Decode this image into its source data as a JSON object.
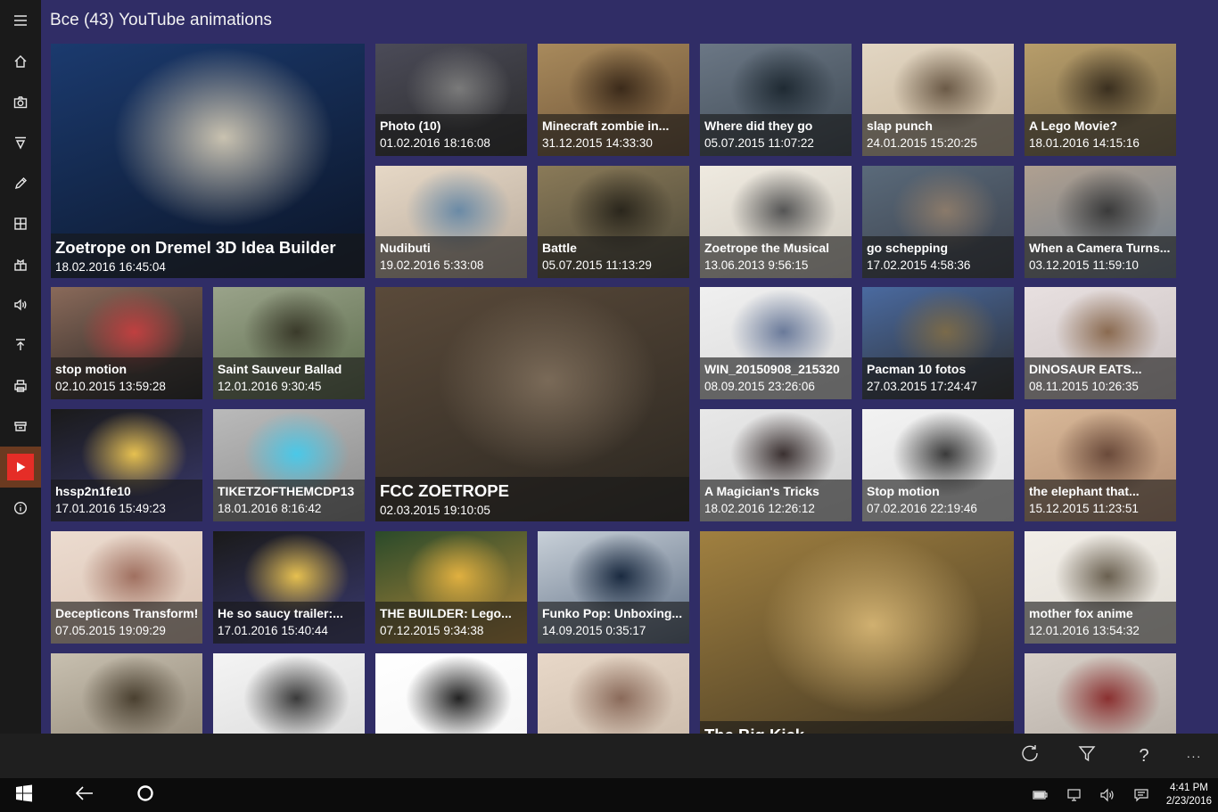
{
  "header": {
    "title": "Все (43) YouTube animations"
  },
  "sidebar": {
    "items": [
      {
        "icon": "menu-icon"
      },
      {
        "icon": "home-icon"
      },
      {
        "icon": "camera-icon"
      },
      {
        "icon": "filter-icon"
      },
      {
        "icon": "pencil-icon"
      },
      {
        "icon": "grid-icon"
      },
      {
        "icon": "tiles-icon"
      },
      {
        "icon": "speaker-icon"
      },
      {
        "icon": "upload-icon"
      },
      {
        "icon": "printer-icon"
      },
      {
        "icon": "store-icon"
      },
      {
        "icon": "youtube-icon",
        "active": true
      },
      {
        "icon": "info-icon"
      }
    ],
    "active_color": "#6b3a20",
    "youtube_color": "#e52d27"
  },
  "tiles": [
    {
      "title": "Zoetrope on Dremel 3D Idea Builder",
      "date": "18.02.2016 16:45:04",
      "big": true
    },
    {
      "title": "Photo (10)",
      "date": "01.02.2016 18:16:08"
    },
    {
      "title": "Minecraft zombie in...",
      "date": "31.12.2015 14:33:30"
    },
    {
      "title": "Where did they go",
      "date": "05.07.2015 11:07:22"
    },
    {
      "title": "slap punch",
      "date": "24.01.2015 15:20:25"
    },
    {
      "title": "A Lego Movie?",
      "date": "18.01.2016 14:15:16"
    },
    {
      "title": "Nudibuti",
      "date": "19.02.2016 5:33:08"
    },
    {
      "title": "Battle",
      "date": "05.07.2015 11:13:29"
    },
    {
      "title": "Zoetrope the Musical",
      "date": "13.06.2013 9:56:15"
    },
    {
      "title": "go schepping",
      "date": "17.02.2015 4:58:36"
    },
    {
      "title": "When a Camera Turns...",
      "date": "03.12.2015 11:59:10"
    },
    {
      "title": "stop motion",
      "date": "02.10.2015 13:59:28"
    },
    {
      "title": "Saint Sauveur Ballad",
      "date": "12.01.2016 9:30:45"
    },
    {
      "title": "FCC ZOETROPE",
      "date": "02.03.2015 19:10:05",
      "big": true
    },
    {
      "title": "WIN_20150908_215320",
      "date": "08.09.2015 23:26:06"
    },
    {
      "title": "Pacman 10 fotos",
      "date": "27.03.2015 17:24:47"
    },
    {
      "title": "DINOSAUR EATS...",
      "date": "08.11.2015 10:26:35"
    },
    {
      "title": "hssp2n1fe10",
      "date": "17.01.2016 15:49:23"
    },
    {
      "title": "TIKETZOFTHEMCDP13",
      "date": "18.01.2016 8:16:42"
    },
    {
      "title": "A Magician's Tricks",
      "date": "18.02.2016 12:26:12"
    },
    {
      "title": "Stop motion",
      "date": "07.02.2016 22:19:46"
    },
    {
      "title": "the elephant that...",
      "date": "15.12.2015 11:23:51"
    },
    {
      "title": "Decepticons Transform!",
      "date": "07.05.2015 19:09:29"
    },
    {
      "title": "He so saucy trailer:...",
      "date": "17.01.2016 15:40:44"
    },
    {
      "title": "THE BUILDER: Lego...",
      "date": "07.12.2015 9:34:38"
    },
    {
      "title": "Funko Pop: Unboxing...",
      "date": "14.09.2015 0:35:17"
    },
    {
      "title": "The Big Kick",
      "date": "",
      "big": true
    },
    {
      "title": "mother fox anime",
      "date": "12.01.2016 13:54:32"
    },
    {
      "title": "",
      "date": ""
    },
    {
      "title": "",
      "date": ""
    },
    {
      "title": "",
      "date": ""
    },
    {
      "title": "",
      "date": ""
    },
    {
      "title": "",
      "date": ""
    }
  ],
  "appbar": {
    "buttons": [
      {
        "icon": "refresh-icon"
      },
      {
        "icon": "filter-icon"
      },
      {
        "icon": "help-icon",
        "glyph": "?"
      },
      {
        "icon": "more-icon",
        "glyph": "···"
      }
    ]
  },
  "taskbar": {
    "clock_time": "4:41 PM",
    "clock_date": "2/23/2016"
  }
}
